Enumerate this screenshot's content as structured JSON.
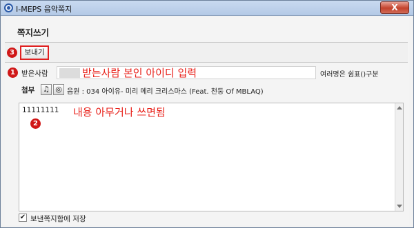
{
  "window": {
    "title": "I-MEPS 음악쪽지",
    "close_glyph": "X"
  },
  "page": {
    "title": "쪽지쓰기"
  },
  "toolbar": {
    "send_label": "보내기"
  },
  "recipient": {
    "label": "받은사람",
    "value": "",
    "hint": "여러명은 쉼표()구분",
    "annotation": "받는사람 본인 아이디 입력"
  },
  "attachment": {
    "label": "첨부",
    "music_icon": "♫",
    "disc_icon": "◎",
    "text": "음원 : 034 아이유- 미리 메리 크리스마스 (Feat. 천둥 Of MBLAQ)"
  },
  "message": {
    "value": "11111111",
    "annotation": "내용 아무거나 쓰면됨"
  },
  "save_to_sent": {
    "label": "보낸쪽지함에 저장",
    "checked": true,
    "check_glyph": "✔"
  },
  "badges": {
    "one": "1",
    "two": "2",
    "three": "3"
  },
  "colors": {
    "annotation_red": "#e8221b",
    "badge_red": "#d01818",
    "titlebar": "#b3c9e6",
    "close_red": "#c4422c"
  }
}
